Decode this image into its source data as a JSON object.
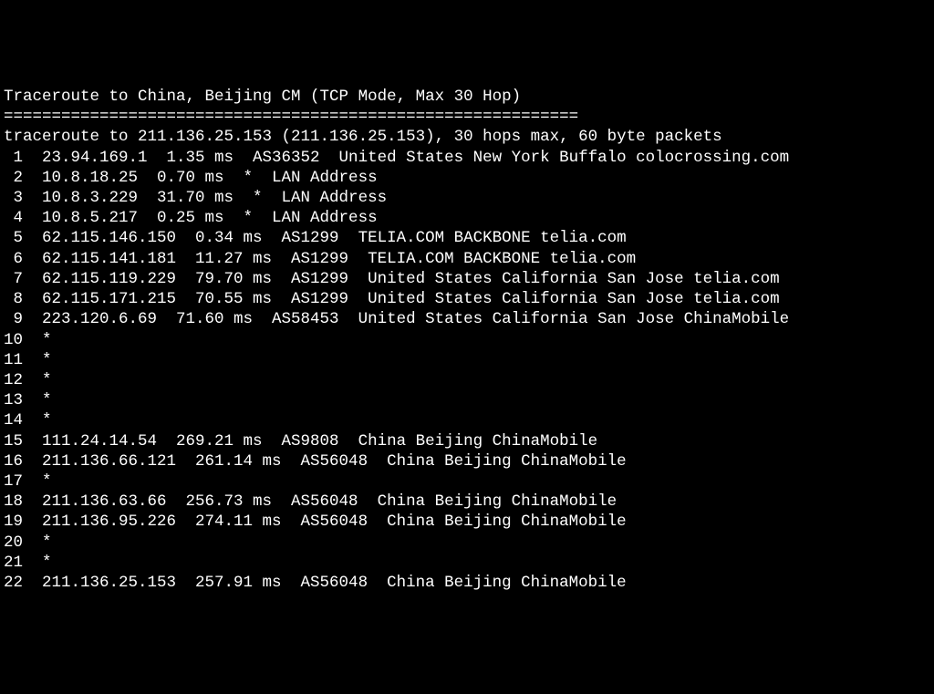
{
  "header": {
    "title": "Traceroute to China, Beijing CM (TCP Mode, Max 30 Hop)",
    "divider": "============================================================",
    "intro": "traceroute to 211.136.25.153 (211.136.25.153), 30 hops max, 60 byte packets"
  },
  "hops": [
    {
      "num": " 1",
      "ip": "23.94.169.1",
      "latency": "1.35 ms",
      "asn": "AS36352",
      "location": "United States New York Buffalo colocrossing.com"
    },
    {
      "num": " 2",
      "ip": "10.8.18.25",
      "latency": "0.70 ms",
      "asn": "*",
      "location": "LAN Address"
    },
    {
      "num": " 3",
      "ip": "10.8.3.229",
      "latency": "31.70 ms",
      "asn": "*",
      "location": "LAN Address"
    },
    {
      "num": " 4",
      "ip": "10.8.5.217",
      "latency": "0.25 ms",
      "asn": "*",
      "location": "LAN Address"
    },
    {
      "num": " 5",
      "ip": "62.115.146.150",
      "latency": "0.34 ms",
      "asn": "AS1299",
      "location": "TELIA.COM BACKBONE telia.com"
    },
    {
      "num": " 6",
      "ip": "62.115.141.181",
      "latency": "11.27 ms",
      "asn": "AS1299",
      "location": "TELIA.COM BACKBONE telia.com"
    },
    {
      "num": " 7",
      "ip": "62.115.119.229",
      "latency": "79.70 ms",
      "asn": "AS1299",
      "location": "United States California San Jose telia.com"
    },
    {
      "num": " 8",
      "ip": "62.115.171.215",
      "latency": "70.55 ms",
      "asn": "AS1299",
      "location": "United States California San Jose telia.com"
    },
    {
      "num": " 9",
      "ip": "223.120.6.69",
      "latency": "71.60 ms",
      "asn": "AS58453",
      "location": "United States California San Jose ChinaMobile"
    },
    {
      "num": "10",
      "ip": "*",
      "latency": "",
      "asn": "",
      "location": ""
    },
    {
      "num": "11",
      "ip": "*",
      "latency": "",
      "asn": "",
      "location": ""
    },
    {
      "num": "12",
      "ip": "*",
      "latency": "",
      "asn": "",
      "location": ""
    },
    {
      "num": "13",
      "ip": "*",
      "latency": "",
      "asn": "",
      "location": ""
    },
    {
      "num": "14",
      "ip": "*",
      "latency": "",
      "asn": "",
      "location": ""
    },
    {
      "num": "15",
      "ip": "111.24.14.54",
      "latency": "269.21 ms",
      "asn": "AS9808",
      "location": "China Beijing ChinaMobile"
    },
    {
      "num": "16",
      "ip": "211.136.66.121",
      "latency": "261.14 ms",
      "asn": "AS56048",
      "location": "China Beijing ChinaMobile"
    },
    {
      "num": "17",
      "ip": "*",
      "latency": "",
      "asn": "",
      "location": ""
    },
    {
      "num": "18",
      "ip": "211.136.63.66",
      "latency": "256.73 ms",
      "asn": "AS56048",
      "location": "China Beijing ChinaMobile"
    },
    {
      "num": "19",
      "ip": "211.136.95.226",
      "latency": "274.11 ms",
      "asn": "AS56048",
      "location": "China Beijing ChinaMobile"
    },
    {
      "num": "20",
      "ip": "*",
      "latency": "",
      "asn": "",
      "location": ""
    },
    {
      "num": "21",
      "ip": "*",
      "latency": "",
      "asn": "",
      "location": ""
    },
    {
      "num": "22",
      "ip": "211.136.25.153",
      "latency": "257.91 ms",
      "asn": "AS56048",
      "location": "China Beijing ChinaMobile"
    }
  ]
}
